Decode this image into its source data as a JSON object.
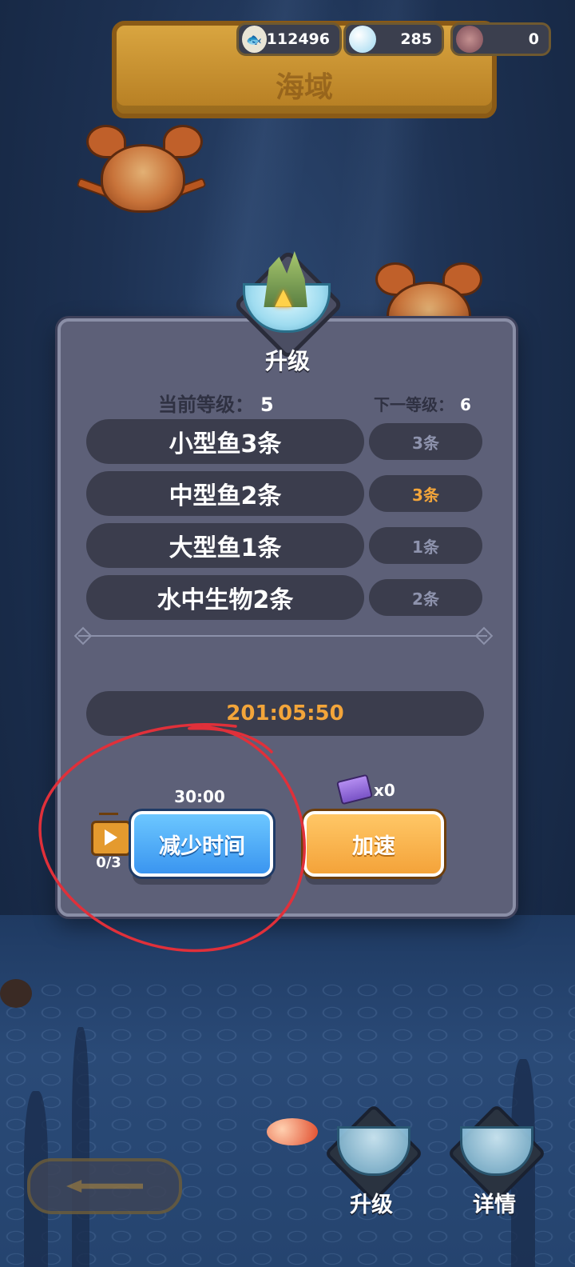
{
  "header": {
    "title": "海域",
    "resources": [
      {
        "icon": "coin-icon",
        "value": "112496"
      },
      {
        "icon": "pearl-icon",
        "value": "285"
      },
      {
        "icon": "shell-icon",
        "value": "0"
      }
    ]
  },
  "modal": {
    "emblem_label": "升级",
    "current_level_label": "当前等级：",
    "current_level": "5",
    "next_level_label": "下一等级：",
    "next_level": "6",
    "requirements": [
      {
        "label": "小型鱼3条",
        "count": "3条",
        "highlight": false
      },
      {
        "label": "中型鱼2条",
        "count": "3条",
        "highlight": true
      },
      {
        "label": "大型鱼1条",
        "count": "1条",
        "highlight": false
      },
      {
        "label": "水中生物2条",
        "count": "2条",
        "highlight": false
      }
    ],
    "timer": "201:05:50",
    "reduce_time": {
      "duration": "30:00",
      "ad_count": "0/3",
      "label": "减少时间"
    },
    "speed_up": {
      "ticket_count": "x0",
      "label": "加速"
    }
  },
  "bottom_bar": {
    "upgrade_label": "升级",
    "details_label": "详情"
  },
  "colors": {
    "accent_orange": "#f3a53a",
    "button_blue": "#3a95f0",
    "panel": "#5d6078"
  }
}
